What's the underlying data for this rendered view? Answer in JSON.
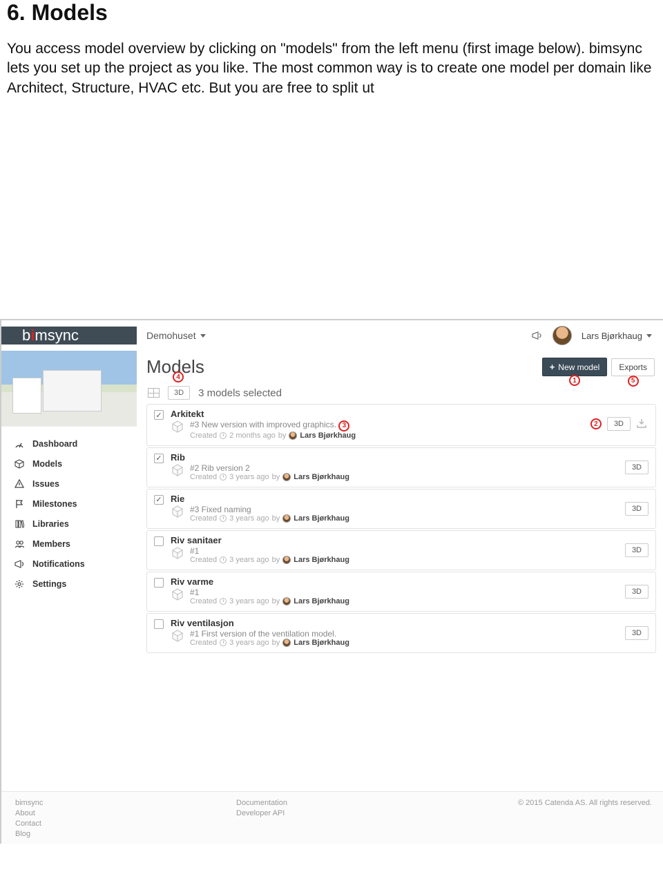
{
  "doc": {
    "heading": "6. Models",
    "paragraph": "You access model overview  by clicking on \"models\" from the left menu (first image below). bimsync lets you set up the project as you like. The most common way is to create one model per domain like Architect, Structure, HVAC etc. But you are free to split ut"
  },
  "app": {
    "logo_prefix": "b",
    "logo_accent": "i",
    "logo_suffix": "msync",
    "project_name": "Demohuset",
    "user_name": "Lars Bjørkhaug"
  },
  "sidebar": {
    "items": [
      "Dashboard",
      "Models",
      "Issues",
      "Milestones",
      "Libraries",
      "Members",
      "Notifications",
      "Settings"
    ]
  },
  "main": {
    "title": "Models",
    "new_model_label": "New model",
    "exports_label": "Exports",
    "selected_btn_3d": "3D",
    "selected_text": "3 models selected"
  },
  "callouts": {
    "c1": "1",
    "c2": "2",
    "c3": "3",
    "c4": "4",
    "c5": "5"
  },
  "models": [
    {
      "name": "Arkitekt",
      "version": "#3 New version with improved graphics.",
      "created_prefix": "Created",
      "time": "2 months ago",
      "by": "by",
      "author": "Lars Bjørkhaug",
      "checked": true,
      "btn3d": "3D",
      "show_c3": true,
      "show_c2": true,
      "show_dl": true
    },
    {
      "name": "Rib",
      "version": "#2 Rib version 2",
      "created_prefix": "Created",
      "time": "3 years ago",
      "by": "by",
      "author": "Lars Bjørkhaug",
      "checked": true,
      "btn3d": "3D"
    },
    {
      "name": "Rie",
      "version": "#3 Fixed naming",
      "created_prefix": "Created",
      "time": "3 years ago",
      "by": "by",
      "author": "Lars Bjørkhaug",
      "checked": true,
      "btn3d": "3D"
    },
    {
      "name": "Riv sanitaer",
      "version": "#1",
      "created_prefix": "Created",
      "time": "3 years ago",
      "by": "by",
      "author": "Lars Bjørkhaug",
      "checked": false,
      "btn3d": "3D"
    },
    {
      "name": "Riv varme",
      "version": "#1",
      "created_prefix": "Created",
      "time": "3 years ago",
      "by": "by",
      "author": "Lars Bjørkhaug",
      "checked": false,
      "btn3d": "3D"
    },
    {
      "name": "Riv ventilasjon",
      "version": "#1 First version of the ventilation model.",
      "created_prefix": "Created",
      "time": "3 years ago",
      "by": "by",
      "author": "Lars Bjørkhaug",
      "checked": false,
      "btn3d": "3D"
    }
  ],
  "footer": {
    "left": [
      "bimsync",
      "About",
      "Contact",
      "Blog"
    ],
    "mid": [
      "Documentation",
      "Developer API"
    ],
    "right": "© 2015 Catenda AS. All rights reserved."
  }
}
